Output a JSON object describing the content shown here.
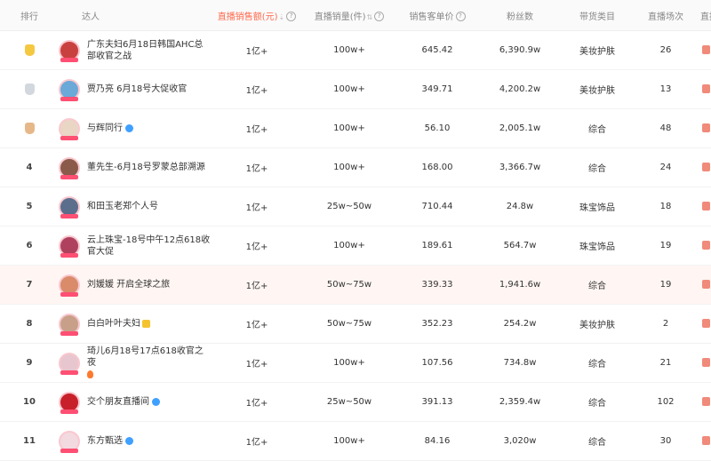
{
  "header": {
    "rank": "排行",
    "influencer": "达人",
    "sales_amount": "直播销售额(元)",
    "sales_volume": "直播销量(件)",
    "unit_price": "销售客单价",
    "fans": "粉丝数",
    "category": "带货类目",
    "live_count": "直播场次",
    "live_room": "直播间"
  },
  "rows": [
    {
      "rank": "",
      "medal": "gold",
      "name": "广东夫妇6月18日韩国AHC总部收官之战",
      "badge": "",
      "amount": "1亿+",
      "volume": "100w+",
      "unit_price": "645.42",
      "fans": "6,390.9w",
      "category": "美妆护肤",
      "count": "26",
      "avatar_color": "#c9413f",
      "highlight": false
    },
    {
      "rank": "",
      "medal": "silver",
      "name": "贾乃亮 6月18号大促收官",
      "badge": "",
      "amount": "1亿+",
      "volume": "100w+",
      "unit_price": "349.71",
      "fans": "4,200.2w",
      "category": "美妆护肤",
      "count": "13",
      "avatar_color": "#6aa9d8",
      "highlight": false
    },
    {
      "rank": "",
      "medal": "bronze",
      "name": "与辉同行",
      "badge": "verify",
      "amount": "1亿+",
      "volume": "100w+",
      "unit_price": "56.10",
      "fans": "2,005.1w",
      "category": "综合",
      "count": "48",
      "avatar_color": "#e9d6c4",
      "highlight": false
    },
    {
      "rank": "4",
      "medal": "",
      "name": "董先生-6月18号罗蒙总部溯源",
      "badge": "",
      "amount": "1亿+",
      "volume": "100w+",
      "unit_price": "168.00",
      "fans": "3,366.7w",
      "category": "综合",
      "count": "24",
      "avatar_color": "#8a5a4a",
      "highlight": false
    },
    {
      "rank": "5",
      "medal": "",
      "name": "和田玉老郑个人号",
      "badge": "",
      "amount": "1亿+",
      "volume": "25w~50w",
      "unit_price": "710.44",
      "fans": "24.8w",
      "category": "珠宝饰品",
      "count": "18",
      "avatar_color": "#5b6e8c",
      "highlight": false
    },
    {
      "rank": "6",
      "medal": "",
      "name": "云上珠宝-18号中午12点618收官大促",
      "badge": "",
      "amount": "1亿+",
      "volume": "100w+",
      "unit_price": "189.61",
      "fans": "564.7w",
      "category": "珠宝饰品",
      "count": "19",
      "avatar_color": "#b0415e",
      "highlight": false
    },
    {
      "rank": "7",
      "medal": "",
      "name": "刘媛媛 开启全球之旅",
      "badge": "",
      "amount": "1亿+",
      "volume": "50w~75w",
      "unit_price": "339.33",
      "fans": "1,941.6w",
      "category": "综合",
      "count": "19",
      "avatar_color": "#d98b6a",
      "highlight": true
    },
    {
      "rank": "8",
      "medal": "",
      "name": "白白叶叶夫妇",
      "badge": "crown",
      "amount": "1亿+",
      "volume": "50w~75w",
      "unit_price": "352.23",
      "fans": "254.2w",
      "category": "美妆护肤",
      "count": "2",
      "avatar_color": "#c8a08a",
      "highlight": false
    },
    {
      "rank": "9",
      "medal": "",
      "name": "琦儿6月18号17点618收官之夜",
      "badge": "fire",
      "amount": "1亿+",
      "volume": "100w+",
      "unit_price": "107.56",
      "fans": "734.8w",
      "category": "综合",
      "count": "21",
      "avatar_color": "#e7c6cf",
      "highlight": false
    },
    {
      "rank": "10",
      "medal": "",
      "name": "交个朋友直播间",
      "badge": "verify",
      "amount": "1亿+",
      "volume": "25w~50w",
      "unit_price": "391.13",
      "fans": "2,359.4w",
      "category": "综合",
      "count": "102",
      "avatar_color": "#c8202a",
      "highlight": false
    },
    {
      "rank": "11",
      "medal": "",
      "name": "东方甄选",
      "badge": "verify",
      "amount": "1亿+",
      "volume": "100w+",
      "unit_price": "84.16",
      "fans": "3,020w",
      "category": "综合",
      "count": "30",
      "avatar_color": "#f3d9e0",
      "highlight": false
    }
  ]
}
